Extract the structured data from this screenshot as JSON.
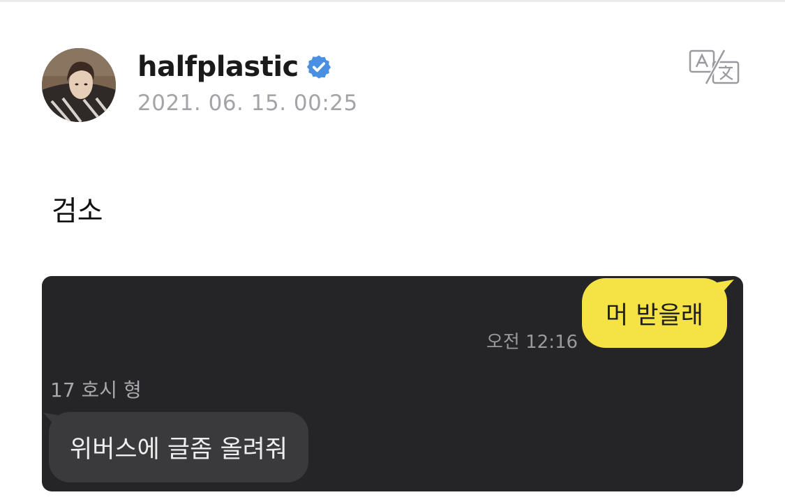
{
  "post": {
    "author": {
      "username": "halfplastic",
      "verified": true,
      "timestamp": "2021. 06. 15. 00:25"
    },
    "icons": {
      "avatar": "profile-photo",
      "verified": "verified-badge-icon",
      "translate": "translate-icon"
    },
    "text": "검소",
    "image": {
      "messages": [
        {
          "direction": "outgoing",
          "text": "머 받을래",
          "time": "오전 12:16"
        },
        {
          "direction": "incoming",
          "sender": "17 호시 형",
          "text": "위버스에 글좀 올려줘"
        }
      ]
    }
  },
  "colors": {
    "verified_badge": "#4a90e2",
    "chat_background": "#252527",
    "outgoing_bubble": "#f5e345",
    "incoming_bubble": "#3a3a3c"
  }
}
